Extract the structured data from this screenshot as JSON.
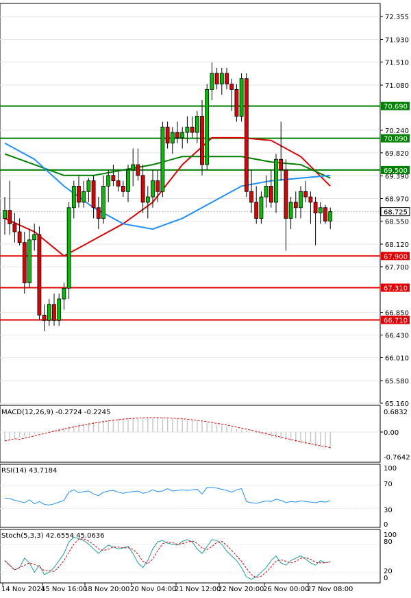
{
  "price_panel": {
    "y_ticks": [
      "72.355",
      "71.930",
      "71.510",
      "71.080",
      "70.240",
      "69.820",
      "69.390",
      "68.970",
      "68.550",
      "68.120",
      "67.700",
      "66.850",
      "66.430",
      "66.010",
      "65.580",
      "65.160"
    ],
    "ylim": [
      65.16,
      72.6
    ],
    "current_price": "68.725",
    "levels": [
      {
        "label": "70.690",
        "value": 70.69,
        "color": "#008000"
      },
      {
        "label": "70.090",
        "value": 70.09,
        "color": "#008000"
      },
      {
        "label": "69.500",
        "value": 69.5,
        "color": "#008000"
      },
      {
        "label": "67.900",
        "value": 67.9,
        "color": "#e00000"
      },
      {
        "label": "67.310",
        "value": 67.31,
        "color": "#e00000"
      },
      {
        "label": "66.710",
        "value": 66.71,
        "color": "#e00000"
      }
    ]
  },
  "macd_panel": {
    "title": "MACD(12,26,9) -0.2724 -0.2245",
    "y_ticks": [
      "0.6832",
      "0.00",
      "-0.7642"
    ]
  },
  "rsi_panel": {
    "title": "RSI(14) 43.7184",
    "y_ticks": [
      "100",
      "70",
      "30",
      "0"
    ]
  },
  "stoch_panel": {
    "title": "Stoch(5,3,3) 42.6554 45.0636",
    "y_ticks": [
      "100",
      "80",
      "20",
      "0"
    ]
  },
  "x_ticks": [
    "14 Nov 2024",
    "15 Nov 16:00",
    "18 Nov 20:00",
    "20 Nov 04:00",
    "21 Nov 12:00",
    "22 Nov 20:00",
    "26 Nov 00:00",
    "27 Nov 08:00"
  ],
  "chart_data": {
    "type": "candlestick",
    "candles": [
      {
        "o": 68.6,
        "h": 69.0,
        "l": 68.3,
        "c": 68.75
      },
      {
        "o": 68.75,
        "h": 69.3,
        "l": 68.3,
        "c": 68.5
      },
      {
        "o": 68.5,
        "h": 68.7,
        "l": 68.15,
        "c": 68.35
      },
      {
        "o": 68.35,
        "h": 68.6,
        "l": 68.1,
        "c": 68.15
      },
      {
        "o": 68.15,
        "h": 68.35,
        "l": 67.2,
        "c": 67.4
      },
      {
        "o": 67.4,
        "h": 68.4,
        "l": 67.3,
        "c": 68.2
      },
      {
        "o": 68.2,
        "h": 68.5,
        "l": 68.0,
        "c": 68.3
      },
      {
        "o": 68.3,
        "h": 68.45,
        "l": 66.7,
        "c": 66.8
      },
      {
        "o": 66.8,
        "h": 67.0,
        "l": 66.5,
        "c": 66.7
      },
      {
        "o": 66.7,
        "h": 67.1,
        "l": 66.6,
        "c": 67.0
      },
      {
        "o": 67.0,
        "h": 67.2,
        "l": 66.6,
        "c": 66.7
      },
      {
        "o": 66.7,
        "h": 67.2,
        "l": 66.6,
        "c": 67.1
      },
      {
        "o": 67.1,
        "h": 67.4,
        "l": 66.9,
        "c": 67.3
      },
      {
        "o": 67.3,
        "h": 68.9,
        "l": 67.1,
        "c": 68.8
      },
      {
        "o": 68.8,
        "h": 69.3,
        "l": 68.6,
        "c": 69.2
      },
      {
        "o": 69.2,
        "h": 69.4,
        "l": 68.8,
        "c": 68.9
      },
      {
        "o": 68.9,
        "h": 69.3,
        "l": 68.8,
        "c": 69.1
      },
      {
        "o": 69.1,
        "h": 69.35,
        "l": 68.9,
        "c": 69.3
      },
      {
        "o": 69.3,
        "h": 69.4,
        "l": 68.6,
        "c": 68.8
      },
      {
        "o": 68.8,
        "h": 69.0,
        "l": 68.4,
        "c": 68.6
      },
      {
        "o": 68.6,
        "h": 69.4,
        "l": 68.5,
        "c": 69.2
      },
      {
        "o": 69.2,
        "h": 69.5,
        "l": 68.9,
        "c": 69.4
      },
      {
        "o": 69.4,
        "h": 69.6,
        "l": 69.2,
        "c": 69.3
      },
      {
        "o": 69.3,
        "h": 69.5,
        "l": 69.1,
        "c": 69.2
      },
      {
        "o": 69.2,
        "h": 69.3,
        "l": 69.0,
        "c": 69.1
      },
      {
        "o": 69.1,
        "h": 69.6,
        "l": 68.9,
        "c": 69.5
      },
      {
        "o": 69.5,
        "h": 69.9,
        "l": 69.2,
        "c": 69.6
      },
      {
        "o": 69.6,
        "h": 69.9,
        "l": 69.3,
        "c": 69.4
      },
      {
        "o": 69.4,
        "h": 69.6,
        "l": 68.7,
        "c": 68.9
      },
      {
        "o": 68.9,
        "h": 69.2,
        "l": 68.6,
        "c": 69.0
      },
      {
        "o": 69.0,
        "h": 69.5,
        "l": 68.8,
        "c": 69.3
      },
      {
        "o": 69.3,
        "h": 69.5,
        "l": 68.9,
        "c": 69.1
      },
      {
        "o": 69.1,
        "h": 70.4,
        "l": 69.0,
        "c": 70.3
      },
      {
        "o": 70.3,
        "h": 70.4,
        "l": 69.9,
        "c": 70.0
      },
      {
        "o": 70.0,
        "h": 70.3,
        "l": 69.8,
        "c": 70.2
      },
      {
        "o": 70.2,
        "h": 70.4,
        "l": 70.0,
        "c": 70.1
      },
      {
        "o": 70.1,
        "h": 70.3,
        "l": 69.9,
        "c": 70.2
      },
      {
        "o": 70.2,
        "h": 70.5,
        "l": 70.0,
        "c": 70.3
      },
      {
        "o": 70.3,
        "h": 70.5,
        "l": 70.1,
        "c": 70.2
      },
      {
        "o": 70.2,
        "h": 70.6,
        "l": 70.0,
        "c": 70.5
      },
      {
        "o": 70.5,
        "h": 70.8,
        "l": 69.4,
        "c": 69.6
      },
      {
        "o": 69.6,
        "h": 71.1,
        "l": 69.5,
        "c": 71.0
      },
      {
        "o": 71.0,
        "h": 71.5,
        "l": 70.8,
        "c": 71.3
      },
      {
        "o": 71.3,
        "h": 71.4,
        "l": 71.0,
        "c": 71.1
      },
      {
        "o": 71.1,
        "h": 71.4,
        "l": 70.9,
        "c": 71.3
      },
      {
        "o": 71.3,
        "h": 71.4,
        "l": 71.0,
        "c": 71.1
      },
      {
        "o": 71.1,
        "h": 71.2,
        "l": 70.6,
        "c": 71.0
      },
      {
        "o": 71.0,
        "h": 71.1,
        "l": 70.4,
        "c": 70.5
      },
      {
        "o": 70.5,
        "h": 71.3,
        "l": 70.4,
        "c": 71.2
      },
      {
        "o": 71.2,
        "h": 71.3,
        "l": 69.0,
        "c": 69.1
      },
      {
        "o": 69.1,
        "h": 69.5,
        "l": 68.7,
        "c": 68.9
      },
      {
        "o": 68.9,
        "h": 69.2,
        "l": 68.5,
        "c": 68.6
      },
      {
        "o": 68.6,
        "h": 69.1,
        "l": 68.5,
        "c": 69.0
      },
      {
        "o": 69.0,
        "h": 69.4,
        "l": 68.8,
        "c": 69.2
      },
      {
        "o": 69.2,
        "h": 69.5,
        "l": 68.8,
        "c": 68.9
      },
      {
        "o": 68.9,
        "h": 69.8,
        "l": 68.7,
        "c": 69.7
      },
      {
        "o": 69.7,
        "h": 70.4,
        "l": 69.3,
        "c": 69.5
      },
      {
        "o": 69.5,
        "h": 69.7,
        "l": 68.0,
        "c": 68.6
      },
      {
        "o": 68.6,
        "h": 69.0,
        "l": 68.4,
        "c": 68.9
      },
      {
        "o": 68.9,
        "h": 69.1,
        "l": 68.6,
        "c": 68.8
      },
      {
        "o": 68.8,
        "h": 69.2,
        "l": 68.6,
        "c": 69.1
      },
      {
        "o": 69.1,
        "h": 69.3,
        "l": 68.9,
        "c": 69.0
      },
      {
        "o": 69.0,
        "h": 69.1,
        "l": 68.5,
        "c": 68.9
      },
      {
        "o": 68.9,
        "h": 69.0,
        "l": 68.1,
        "c": 68.7
      },
      {
        "o": 68.7,
        "h": 68.9,
        "l": 68.5,
        "c": 68.8
      },
      {
        "o": 68.8,
        "h": 68.85,
        "l": 68.5,
        "c": 68.55
      },
      {
        "o": 68.55,
        "h": 68.8,
        "l": 68.4,
        "c": 68.725
      }
    ],
    "moving_averages": [
      {
        "color": "#e00000",
        "points": [
          [
            0,
            68.6
          ],
          [
            6,
            68.35
          ],
          [
            12,
            67.9
          ],
          [
            18,
            68.2
          ],
          [
            24,
            68.5
          ],
          [
            30,
            68.9
          ],
          [
            36,
            69.6
          ],
          [
            42,
            70.1
          ],
          [
            48,
            70.1
          ],
          [
            54,
            70.05
          ],
          [
            60,
            69.75
          ],
          [
            66,
            69.2
          ]
        ]
      },
      {
        "color": "#008000",
        "points": [
          [
            0,
            69.8
          ],
          [
            6,
            69.6
          ],
          [
            12,
            69.4
          ],
          [
            18,
            69.4
          ],
          [
            24,
            69.5
          ],
          [
            30,
            69.6
          ],
          [
            36,
            69.75
          ],
          [
            42,
            69.75
          ],
          [
            48,
            69.75
          ],
          [
            54,
            69.65
          ],
          [
            60,
            69.6
          ],
          [
            66,
            69.35
          ]
        ]
      },
      {
        "color": "#1e90ff",
        "points": [
          [
            0,
            70.0
          ],
          [
            6,
            69.7
          ],
          [
            12,
            69.2
          ],
          [
            18,
            68.8
          ],
          [
            24,
            68.5
          ],
          [
            30,
            68.4
          ],
          [
            36,
            68.6
          ],
          [
            42,
            68.9
          ],
          [
            48,
            69.2
          ],
          [
            54,
            69.3
          ],
          [
            60,
            69.35
          ],
          [
            66,
            69.4
          ]
        ]
      }
    ]
  }
}
